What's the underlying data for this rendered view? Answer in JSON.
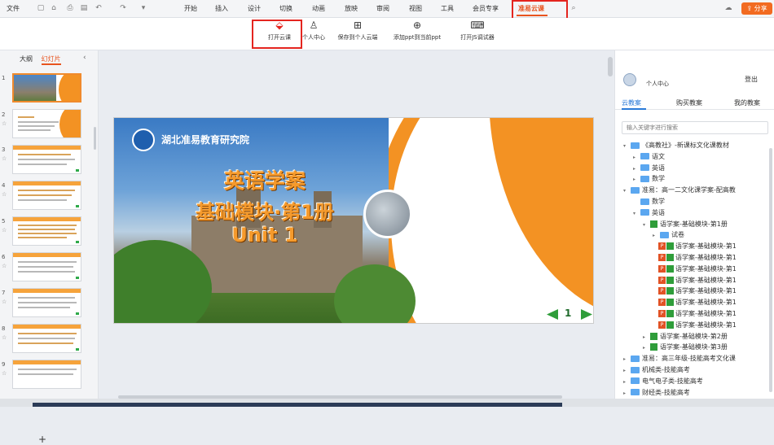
{
  "menubar": {
    "file_label": "文件",
    "tabs": [
      {
        "label": "开始"
      },
      {
        "label": "插入"
      },
      {
        "label": "设计"
      },
      {
        "label": "切换"
      },
      {
        "label": "动画"
      },
      {
        "label": "放映"
      },
      {
        "label": "审阅"
      },
      {
        "label": "视图"
      },
      {
        "label": "工具"
      },
      {
        "label": "会员专享"
      },
      {
        "label": "准易云课"
      }
    ],
    "active_tab": "准易云课",
    "share_label": "分享",
    "accent_color": "#e8541f"
  },
  "ribbon": {
    "buttons": [
      {
        "label": "打开云课",
        "icon": "cloud-open-icon"
      },
      {
        "label": "个人中心",
        "icon": "person-icon"
      },
      {
        "label": "保存到个人云端",
        "icon": "save-cloud-icon"
      },
      {
        "label": "添加ppt到当前ppt",
        "icon": "add-icon"
      },
      {
        "label": "打开JS调试器",
        "icon": "debug-icon"
      }
    ]
  },
  "left_pane": {
    "tabs": [
      {
        "label": "大纲"
      },
      {
        "label": "幻灯片"
      }
    ],
    "active_tab": "幻灯片",
    "slide_numbers": [
      "1",
      "2",
      "3",
      "4",
      "5",
      "6",
      "7",
      "8",
      "9"
    ],
    "add_label": "+"
  },
  "slide": {
    "org_name": "湖北准易教育研究院",
    "title_line1": "英语学案",
    "title_line2": "基础模块·第1册",
    "title_line3": "Unit 1",
    "page_number": "1"
  },
  "right_pane": {
    "user_label": "个人中心",
    "logout_label": "登出",
    "tabs": [
      {
        "label": "云教案"
      },
      {
        "label": "购买教案"
      },
      {
        "label": "我的教案"
      }
    ],
    "active_tab": "云教案",
    "search_placeholder": "输入关键字进行搜索",
    "tree": [
      {
        "label": "《高教社》-新课标文化课教材",
        "type": "folder",
        "depth": 0,
        "toggle": "▾"
      },
      {
        "label": "语文",
        "type": "folder",
        "depth": 1,
        "toggle": "▸"
      },
      {
        "label": "英语",
        "type": "folder",
        "depth": 1,
        "toggle": "▸"
      },
      {
        "label": "数学",
        "type": "folder",
        "depth": 1,
        "toggle": "▸"
      },
      {
        "label": "准易：高一二文化课学案-配高教",
        "type": "folder",
        "depth": 0,
        "toggle": "▾"
      },
      {
        "label": "数学",
        "type": "folder",
        "depth": 1,
        "toggle": ""
      },
      {
        "label": "英语",
        "type": "folder",
        "depth": 1,
        "toggle": "▾"
      },
      {
        "label": "语学案-基础模块-第1册",
        "type": "filegroup",
        "depth": 2,
        "toggle": "▾"
      },
      {
        "label": "试卷",
        "type": "folder",
        "depth": 3,
        "toggle": "▸"
      },
      {
        "label": "语学案-基础模块-第1",
        "type": "ppt",
        "depth": 3,
        "toggle": ""
      },
      {
        "label": "语学案-基础模块-第1",
        "type": "ppt",
        "depth": 3,
        "toggle": ""
      },
      {
        "label": "语学案-基础模块-第1",
        "type": "ppt",
        "depth": 3,
        "toggle": ""
      },
      {
        "label": "语学案-基础模块-第1",
        "type": "ppt",
        "depth": 3,
        "toggle": ""
      },
      {
        "label": "语学案-基础模块-第1",
        "type": "ppt",
        "depth": 3,
        "toggle": ""
      },
      {
        "label": "语学案-基础模块-第1",
        "type": "ppt",
        "depth": 3,
        "toggle": ""
      },
      {
        "label": "语学案-基础模块-第1",
        "type": "ppt",
        "depth": 3,
        "toggle": ""
      },
      {
        "label": "语学案-基础模块-第1",
        "type": "ppt",
        "depth": 3,
        "toggle": ""
      },
      {
        "label": "语学案-基础模块-第2册",
        "type": "filegroup",
        "depth": 2,
        "toggle": "▸"
      },
      {
        "label": "语学案-基础模块-第3册",
        "type": "filegroup",
        "depth": 2,
        "toggle": "▸"
      },
      {
        "label": "准易：高三年级-技能高考文化课",
        "type": "folder",
        "depth": 0,
        "toggle": "▸"
      },
      {
        "label": "机械类-技能高考",
        "type": "folder",
        "depth": 0,
        "toggle": "▸"
      },
      {
        "label": "电气电子类-技能高考",
        "type": "folder",
        "depth": 0,
        "toggle": "▸"
      },
      {
        "label": "财经类-技能高考",
        "type": "folder",
        "depth": 0,
        "toggle": "▸"
      }
    ]
  }
}
